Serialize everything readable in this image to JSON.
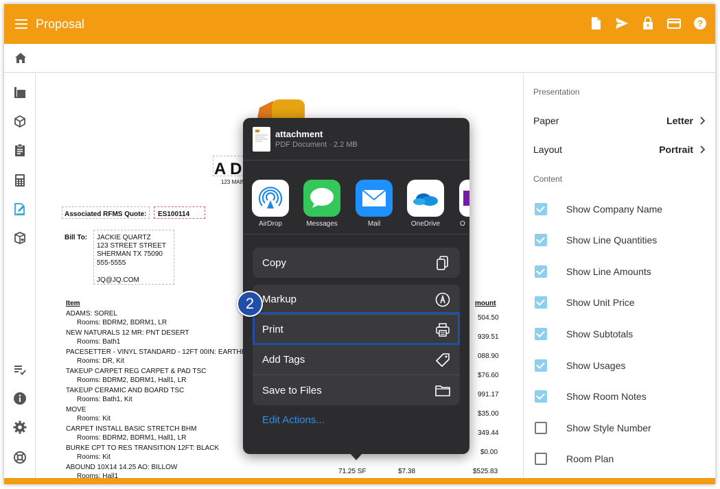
{
  "app": {
    "title": "Proposal"
  },
  "colors": {
    "accent": "#f39c12",
    "link": "#2f8fe8",
    "highlight": "#1f4fa8",
    "checkbox": "#8ecff0"
  },
  "top_actions": [
    "document-icon",
    "send-icon",
    "lock-icon",
    "card-icon",
    "help-icon"
  ],
  "left_nav": [
    "layers-icon",
    "cube-icon",
    "clipboard-icon",
    "calculator-icon",
    "edit-document-icon",
    "package-icon",
    "checklist-icon",
    "info-icon",
    "settings-icon",
    "lifebuoy-icon"
  ],
  "document": {
    "company_title": "A DE",
    "company_address": "123 MAIN",
    "quote_label": "Associated RFMS Quote:",
    "quote_number": "ES100114",
    "bill_to_label": "Bill To:",
    "bill_to_lines": [
      "JACKIE QUARTZ",
      "123 STREET STREET",
      "SHERMAN TX 75090",
      "555-5555",
      "",
      "JQ@JQ.COM"
    ],
    "item_header": "Item",
    "amount_header": "mount",
    "lines": [
      {
        "name": "ADAMS: SOREL",
        "rooms": "Rooms: BDRM2, BDRM1, LR",
        "amount": "504.50"
      },
      {
        "name": "NEW NATURALS 12 MR: PNT DESERT",
        "rooms": "Rooms: Bath1",
        "amount": "939.51"
      },
      {
        "name": "PACESETTER - VINYL STANDARD - 12FT 00IN: EARTHEN",
        "rooms": "Rooms: DR, Kit",
        "amount": "088.90"
      },
      {
        "name": "TAKEUP CARPET REG CARPET & PAD TSC",
        "rooms": "Rooms: BDRM2, BDRM1, Hall1, LR",
        "amount": "$76.60"
      },
      {
        "name": "TAKEUP CERAMIC AND BOARD TSC",
        "rooms": "Rooms: Bath1, Kit",
        "amount": "991.17"
      },
      {
        "name": "MOVE",
        "rooms": "Rooms: Kit",
        "amount": "$35.00"
      },
      {
        "name": "CARPET INSTALL BASIC STRETCH BHM",
        "rooms": "Rooms: BDRM2, BDRM1, Hall1, LR",
        "amount": "349.44"
      },
      {
        "name": "BURKE CPT TO RES TRANSITION 12FT: BLACK",
        "rooms": "Rooms: Kit",
        "amount": "$0.00"
      },
      {
        "name": "ABOUND 10X14 14.25 AO: BILLOW",
        "rooms": "Rooms: Hall1",
        "amount": "$525.83",
        "qty": "71.25 SF",
        "price": "$7.38"
      }
    ]
  },
  "share_sheet": {
    "file_name": "attachment",
    "file_meta": "PDF Document · 2.2 MB",
    "apps": [
      {
        "name": "AirDrop",
        "icon": "airdrop-icon",
        "color": "#ffffff"
      },
      {
        "name": "Messages",
        "icon": "messages-icon",
        "color": "#34c759"
      },
      {
        "name": "Mail",
        "icon": "mail-icon",
        "color": "#1e90ff"
      },
      {
        "name": "OneDrive",
        "icon": "onedrive-icon",
        "color": "#ffffff"
      },
      {
        "name": "O",
        "icon": "onenote-icon",
        "color": "#ffffff"
      }
    ],
    "actions_group1": [
      {
        "label": "Copy",
        "icon": "copy-icon"
      }
    ],
    "actions_group2": [
      {
        "label": "Markup",
        "icon": "markup-icon"
      },
      {
        "label": "Print",
        "icon": "print-icon"
      },
      {
        "label": "Add Tags",
        "icon": "tag-icon"
      },
      {
        "label": "Save to Files",
        "icon": "folder-icon"
      }
    ],
    "edit_actions": "Edit Actions..."
  },
  "callout": {
    "step": "2"
  },
  "right_panel": {
    "presentation_label": "Presentation",
    "paper_label": "Paper",
    "paper_value": "Letter",
    "layout_label": "Layout",
    "layout_value": "Portrait",
    "content_label": "Content",
    "options": [
      {
        "label": "Show Company Name",
        "checked": true
      },
      {
        "label": "Show Line Quantities",
        "checked": true
      },
      {
        "label": "Show Line Amounts",
        "checked": true
      },
      {
        "label": "Show Unit Price",
        "checked": true
      },
      {
        "label": "Show Subtotals",
        "checked": true
      },
      {
        "label": "Show Usages",
        "checked": true
      },
      {
        "label": "Show Room Notes",
        "checked": true
      },
      {
        "label": "Show Style Number",
        "checked": false
      },
      {
        "label": "Room Plan",
        "checked": false
      }
    ]
  }
}
